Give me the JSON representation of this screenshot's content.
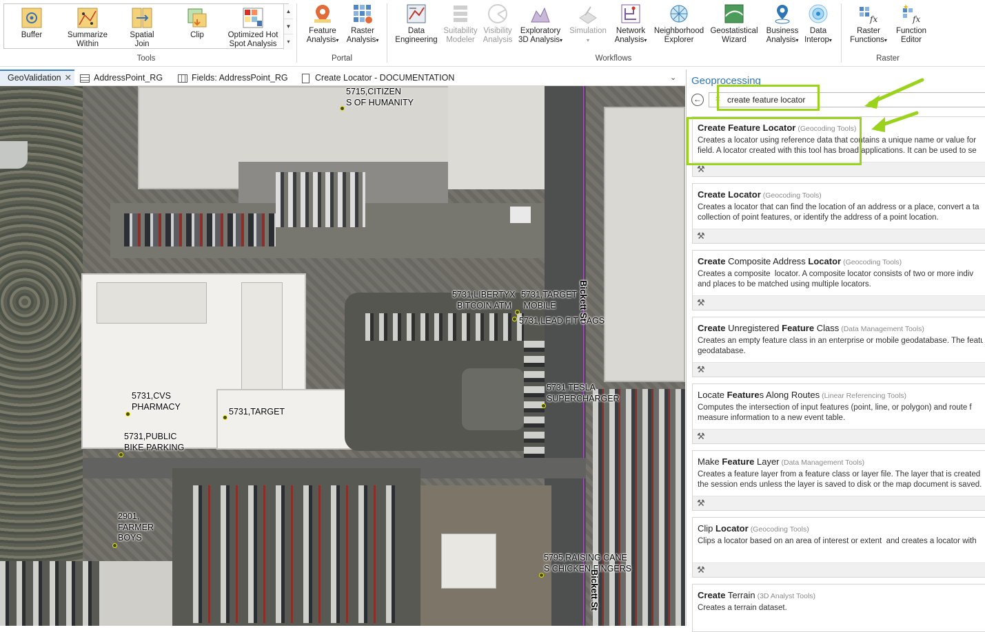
{
  "ribbon": {
    "tools": {
      "buffer": "Buffer",
      "summarize_within": "Summarize\nWithin",
      "spatial_join": "Spatial\nJoin",
      "clip": "Clip",
      "optimized_hot_spot": "Optimized Hot\nSpot Analysis",
      "group": "Tools"
    },
    "portal": {
      "feature_analysis": "Feature\nAnalysis",
      "raster_analysis": "Raster\nAnalysis",
      "group": "Portal"
    },
    "workflows": {
      "data_engineering": "Data\nEngineering",
      "suitability_modeler": "Suitability\nModeler",
      "visibility_analysis": "Visibility\nAnalysis",
      "exploratory_3d": "Exploratory\n3D Analysis",
      "simulation": "Simulation",
      "network_analysis": "Network\nAnalysis",
      "neighborhood_explorer": "Neighborhood\nExplorer",
      "geostatistical_wizard": "Geostatistical\nWizard",
      "business_analysis": "Business\nAnalysis",
      "data_interop": "Data\nInterop",
      "group": "Workflows"
    },
    "raster": {
      "raster_functions": "Raster\nFunctions",
      "function_editor": "Function\nEditor",
      "group": "Raster"
    }
  },
  "tabs": [
    {
      "label": "GeoValidation",
      "close": "✕"
    },
    {
      "label": "AddressPoint_RG"
    },
    {
      "label": "Fields: AddressPoint_RG"
    },
    {
      "label": "Create Locator - DOCUMENTATION"
    }
  ],
  "map": {
    "labels": [
      "5715,CITIZEN\nS OF HUMANITY",
      "5731,LIBERTYX\n  BITCOIN ATM",
      "5731,TARGET\n MOBILE",
      "5731,LEAD FIT BAGS",
      "5731,TESLA\nSUPERCHARGER",
      "5731,CVS\nPHARMACY",
      "5731,TARGET",
      "5731,PUBLIC\nBIKE PARKING",
      "2901,\nFARMER\nBOYS",
      "5795,RAISING CANE\nS CHICKEN FINGERS"
    ],
    "streets": [
      "Bickett St",
      "Bickett St"
    ]
  },
  "geoprocessing": {
    "title": "Geoprocessing",
    "search_value": "create feature locator",
    "results": [
      {
        "name_bold": "Create Feature Locator",
        "name_rest": "",
        "category": "(Geocoding Tools)",
        "desc": "Creates a locator using reference data that contains a unique name or value for\nfield. A locator created with this tool has broad applications. It can be used to se"
      },
      {
        "name_bold": "Create Locator",
        "name_rest": "",
        "category": "(Geocoding Tools)",
        "desc": "Creates a locator that can find the location of an address or a place, convert a ta\ncollection of point features, or identify the address of a point location."
      },
      {
        "name_bold": "Create",
        "name_mid": " Composite Address ",
        "name_bold2": "Locator",
        "category": "(Geocoding Tools)",
        "desc": "Creates a composite  locator. A composite locator consists of two or more indiv\nand places to be matched using multiple locators."
      },
      {
        "name_bold": "Create",
        "name_mid": " Unregistered ",
        "name_bold2": "Feature",
        "name_rest": " Class",
        "category": "(Data Management Tools)",
        "desc": "Creates an empty feature class in an enterprise or mobile geodatabase. The featu\ngeodatabase."
      },
      {
        "name_pre": "Locate ",
        "name_bold": "Feature",
        "name_rest": "s Along Routes",
        "category": "(Linear Referencing Tools)",
        "desc": "Computes the intersection of input features (point, line, or polygon) and route f\nmeasure information to a new event table."
      },
      {
        "name_pre": "Make ",
        "name_bold": "Feature",
        "name_rest": " Layer",
        "category": "(Data Management Tools)",
        "desc": "Creates a feature layer from a feature class or layer file. The layer that is created i\nthe session ends unless the layer is saved to disk or the map document is saved."
      },
      {
        "name_pre": "Clip ",
        "name_bold": "Locator",
        "name_rest": "",
        "category": "(Geocoding Tools)",
        "desc": "Clips a locator based on an area of interest or extent  and creates a locator with"
      },
      {
        "name_bold": "Create",
        "name_rest": " Terrain",
        "category": "(3D Analyst Tools)",
        "desc": "Creates a terrain dataset."
      }
    ]
  },
  "colors": {
    "highlight": "#9bd21c",
    "accent": "#2e75b6"
  }
}
